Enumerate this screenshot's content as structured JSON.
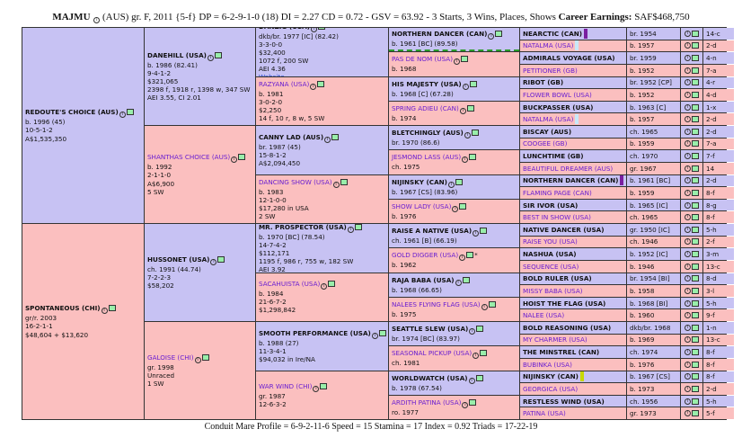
{
  "header": {
    "name": "MAJMU",
    "info": "(AUS) gr. F, 2011 {5-f} DP = 6-2-9-1-0 (18) DI = 2.27 CD = 0.72 - GSV = 63.92 - 3 Starts, 3 Wins, Places, Shows",
    "earn_label": "Career Earnings:",
    "earn_value": "SAF$468,750"
  },
  "footer": "Conduit Mare Profile = 6-9-2-11-6 Speed = 15 Stamina = 17 Index = 0.92 Triads = 17-22-19",
  "g1": [
    {
      "name": "REDOUTE'S CHOICE (AUS)",
      "lines": [
        "b. 1996 (45)",
        "10-5-1-2",
        "A$1,535,350"
      ]
    },
    {
      "name": "SPONTANEOUS (CHI)",
      "lines": [
        "gr/r. 2003",
        "16-2-1-1",
        "$48,604 + $13,620"
      ]
    }
  ],
  "g2": [
    {
      "name": "DANEHILL (USA)",
      "lines": [
        "b. 1986 (82.41)",
        "9-4-1-2",
        "$321,065",
        "2398 f, 1918 r, 1398 w, 347 SW",
        "AEI 3.55, CI 2.01"
      ]
    },
    {
      "name": "SHANTHAS CHOICE (AUS)",
      "lines": [
        "b. 1992",
        "2-1-1-0",
        "A$6,900",
        "5 SW"
      ]
    },
    {
      "name": "HUSSONET (USA)",
      "lines": [
        "ch. 1991 (44.74)",
        "7-2-2-3",
        "$58,202"
      ]
    },
    {
      "name": "GALOISE (CHI)",
      "lines": [
        "gr. 1998",
        "Unraced",
        "1 SW"
      ]
    }
  ],
  "g3": [
    {
      "name": "DANZIG (USA)",
      "lines": [
        "dkb/br. 1977 [IC] (82.42)",
        "3-3-0-0",
        "$32,400",
        "1072 f, 200 SW",
        "AEI 4.36"
      ],
      "link": "Website"
    },
    {
      "name": "RAZYANA (USA)",
      "lines": [
        "b. 1981",
        "3-0-2-0",
        "$2,250",
        "14 f, 10 r, 8 w, 5 SW"
      ]
    },
    {
      "name": "CANNY LAD (AUS)",
      "lines": [
        "br. 1987 (45)",
        "15-8-1-2",
        "A$2,094,450"
      ]
    },
    {
      "name": "DANCING SHOW (USA)",
      "lines": [
        "b. 1983",
        "12-1-0-0",
        "$17,280 in USA",
        "2 SW"
      ]
    },
    {
      "name": "MR. PROSPECTOR (USA)",
      "lines": [
        "b. 1970 [BC] (78.54)",
        "14-7-4-2",
        "$112,171",
        "1195 f, 986 r, 755 w, 182 SW",
        "AEI 3.92"
      ]
    },
    {
      "name": "SACAHUISTA (USA)",
      "lines": [
        "b. 1984",
        "21-6-7-2",
        "$1,298,842"
      ]
    },
    {
      "name": "SMOOTH PERFORMANCE (USA)",
      "lines": [
        "b. 1988 (27)",
        "11-3-4-1",
        "$94,032 in Ire/NA"
      ]
    },
    {
      "name": "WAR WIND (CHI)",
      "lines": [
        "gr. 1987",
        "12-6-3-2"
      ]
    }
  ],
  "g4": [
    {
      "name": "NORTHERN DANCER (CAN)",
      "line": "b. 1961 [BC] (89.58)"
    },
    {
      "name": "PAS DE NOM (USA)",
      "line": "b. 1968"
    },
    {
      "name": "HIS MAJESTY (USA)",
      "line": "b. 1968 [C] (67.28)"
    },
    {
      "name": "SPRING ADIEU (CAN)",
      "line": "b. 1974"
    },
    {
      "name": "BLETCHINGLY (AUS)",
      "line": "br. 1970 (86.6)"
    },
    {
      "name": "JESMOND LASS (AUS)",
      "line": "ch. 1975"
    },
    {
      "name": "NIJINSKY (CAN)",
      "line": "b. 1967 [CS] (83.96)"
    },
    {
      "name": "SHOW LADY (USA)",
      "line": "b. 1976"
    },
    {
      "name": "RAISE A NATIVE (USA)",
      "line": "ch. 1961 [B] (66.19)"
    },
    {
      "name": "GOLD DIGGER (USA)",
      "line": "b. 1962"
    },
    {
      "name": "RAJA BABA (USA)",
      "line": "b. 1968 (66.65)"
    },
    {
      "name": "NALEES FLYING FLAG (USA)",
      "line": "b. 1975"
    },
    {
      "name": "SEATTLE SLEW (USA)",
      "line": "br. 1974 [BC] (83.97)"
    },
    {
      "name": "SEASONAL PICKUP (USA)",
      "line": "ch. 1981"
    },
    {
      "name": "WORLDWATCH (USA)",
      "line": "b. 1978 (67.54)"
    },
    {
      "name": "ARDITH PATINA (USA)",
      "line": "ro. 1977"
    }
  ],
  "g5": [
    {
      "name": "NEARCTIC (CAN)",
      "born": "br. 1954",
      "n1": "14-c",
      "n2": "",
      "bar": "#7a1fa0"
    },
    {
      "name": "NATALMA (USA)",
      "born": "b. 1957",
      "n1": "2-d",
      "n2": "",
      "bar": "#c8e8f8"
    },
    {
      "name": "ADMIRALS VOYAGE (USA)",
      "born": "br. 1959",
      "n1": "4-n",
      "n2": ""
    },
    {
      "name": "PETITIONER (GB)",
      "born": "b. 1952",
      "n1": "7-a",
      "n2": ""
    },
    {
      "name": "RIBOT (GB)",
      "born": "br. 1952 [CP]",
      "n1": "4-r",
      "n2": ""
    },
    {
      "name": "FLOWER BOWL (USA)",
      "born": "b. 1952",
      "n1": "4-d",
      "n2": ""
    },
    {
      "name": "BUCKPASSER (USA)",
      "born": "b. 1963 [C]",
      "n1": "1-x",
      "n2": ""
    },
    {
      "name": "NATALMA (USA)",
      "born": "b. 1957",
      "n1": "2-d",
      "n2": "",
      "bar": "#c8e8f8"
    },
    {
      "name": "BISCAY (AUS)",
      "born": "ch. 1965",
      "n1": "2-d",
      "n2": ""
    },
    {
      "name": "COOGEE (GB)",
      "born": "b. 1959",
      "n1": "7-a",
      "n2": ""
    },
    {
      "name": "LUNCHTIME (GB)",
      "born": "ch. 1970",
      "n1": "7-f",
      "n2": ""
    },
    {
      "name": "BEAUTIFUL DREAMER (AUS)",
      "born": "gr. 1967",
      "n1": "14",
      "n2": ""
    },
    {
      "name": "NORTHERN DANCER (CAN)",
      "born": "b. 1961 [BC]",
      "n1": "2-d",
      "n2": "",
      "bar": "#7a1fa0"
    },
    {
      "name": "FLAMING PAGE (CAN)",
      "born": "b. 1959",
      "n1": "8-f",
      "n2": ""
    },
    {
      "name": "SIR IVOR (USA)",
      "born": "b. 1965 [IC]",
      "n1": "8-g",
      "n2": ""
    },
    {
      "name": "BEST IN SHOW (USA)",
      "born": "ch. 1965",
      "n1": "8-f",
      "n2": ""
    },
    {
      "name": "NATIVE DANCER (USA)",
      "born": "gr. 1950 [IC]",
      "n1": "5-h",
      "n2": ""
    },
    {
      "name": "RAISE YOU (USA)",
      "born": "ch. 1946",
      "n1": "2-f",
      "n2": ""
    },
    {
      "name": "NASHUA (USA)",
      "born": "b. 1952 [IC]",
      "n1": "3-m",
      "n2": ""
    },
    {
      "name": "SEQUENCE (USA)",
      "born": "b. 1946",
      "n1": "13-c",
      "n2": ""
    },
    {
      "name": "BOLD RULER (USA)",
      "born": "br. 1954 [BI]",
      "n1": "8-d",
      "n2": ""
    },
    {
      "name": "MISSY BABA (USA)",
      "born": "b. 1958",
      "n1": "3-l",
      "n2": ""
    },
    {
      "name": "HOIST THE FLAG (USA)",
      "born": "b. 1968 [BI]",
      "n1": "5-h",
      "n2": ""
    },
    {
      "name": "NALEE (USA)",
      "born": "b. 1960",
      "n1": "9-f",
      "n2": ""
    },
    {
      "name": "BOLD REASONING (USA)",
      "born": "dkb/br. 1968",
      "n1": "1-n",
      "n2": ""
    },
    {
      "name": "MY CHARMER (USA)",
      "born": "b. 1969",
      "n1": "13-c",
      "n2": ""
    },
    {
      "name": "THE MINSTREL (CAN)",
      "born": "ch. 1974",
      "n1": "8-f",
      "n2": ""
    },
    {
      "name": "BUBINKA (USA)",
      "born": "b. 1976",
      "n1": "8-f",
      "n2": ""
    },
    {
      "name": "NIJINSKY (CAN)",
      "born": "b. 1967 [CS]",
      "n1": "8-f",
      "n2": "",
      "bar": "#c8d800"
    },
    {
      "name": "GEORGICA (USA)",
      "born": "b. 1973",
      "n1": "2-d",
      "n2": ""
    },
    {
      "name": "RESTLESS WIND (USA)",
      "born": "ch. 1956",
      "n1": "5-h",
      "n2": ""
    },
    {
      "name": "PATINA (USA)",
      "born": "gr. 1973",
      "n1": "5-f",
      "n2": ""
    }
  ]
}
